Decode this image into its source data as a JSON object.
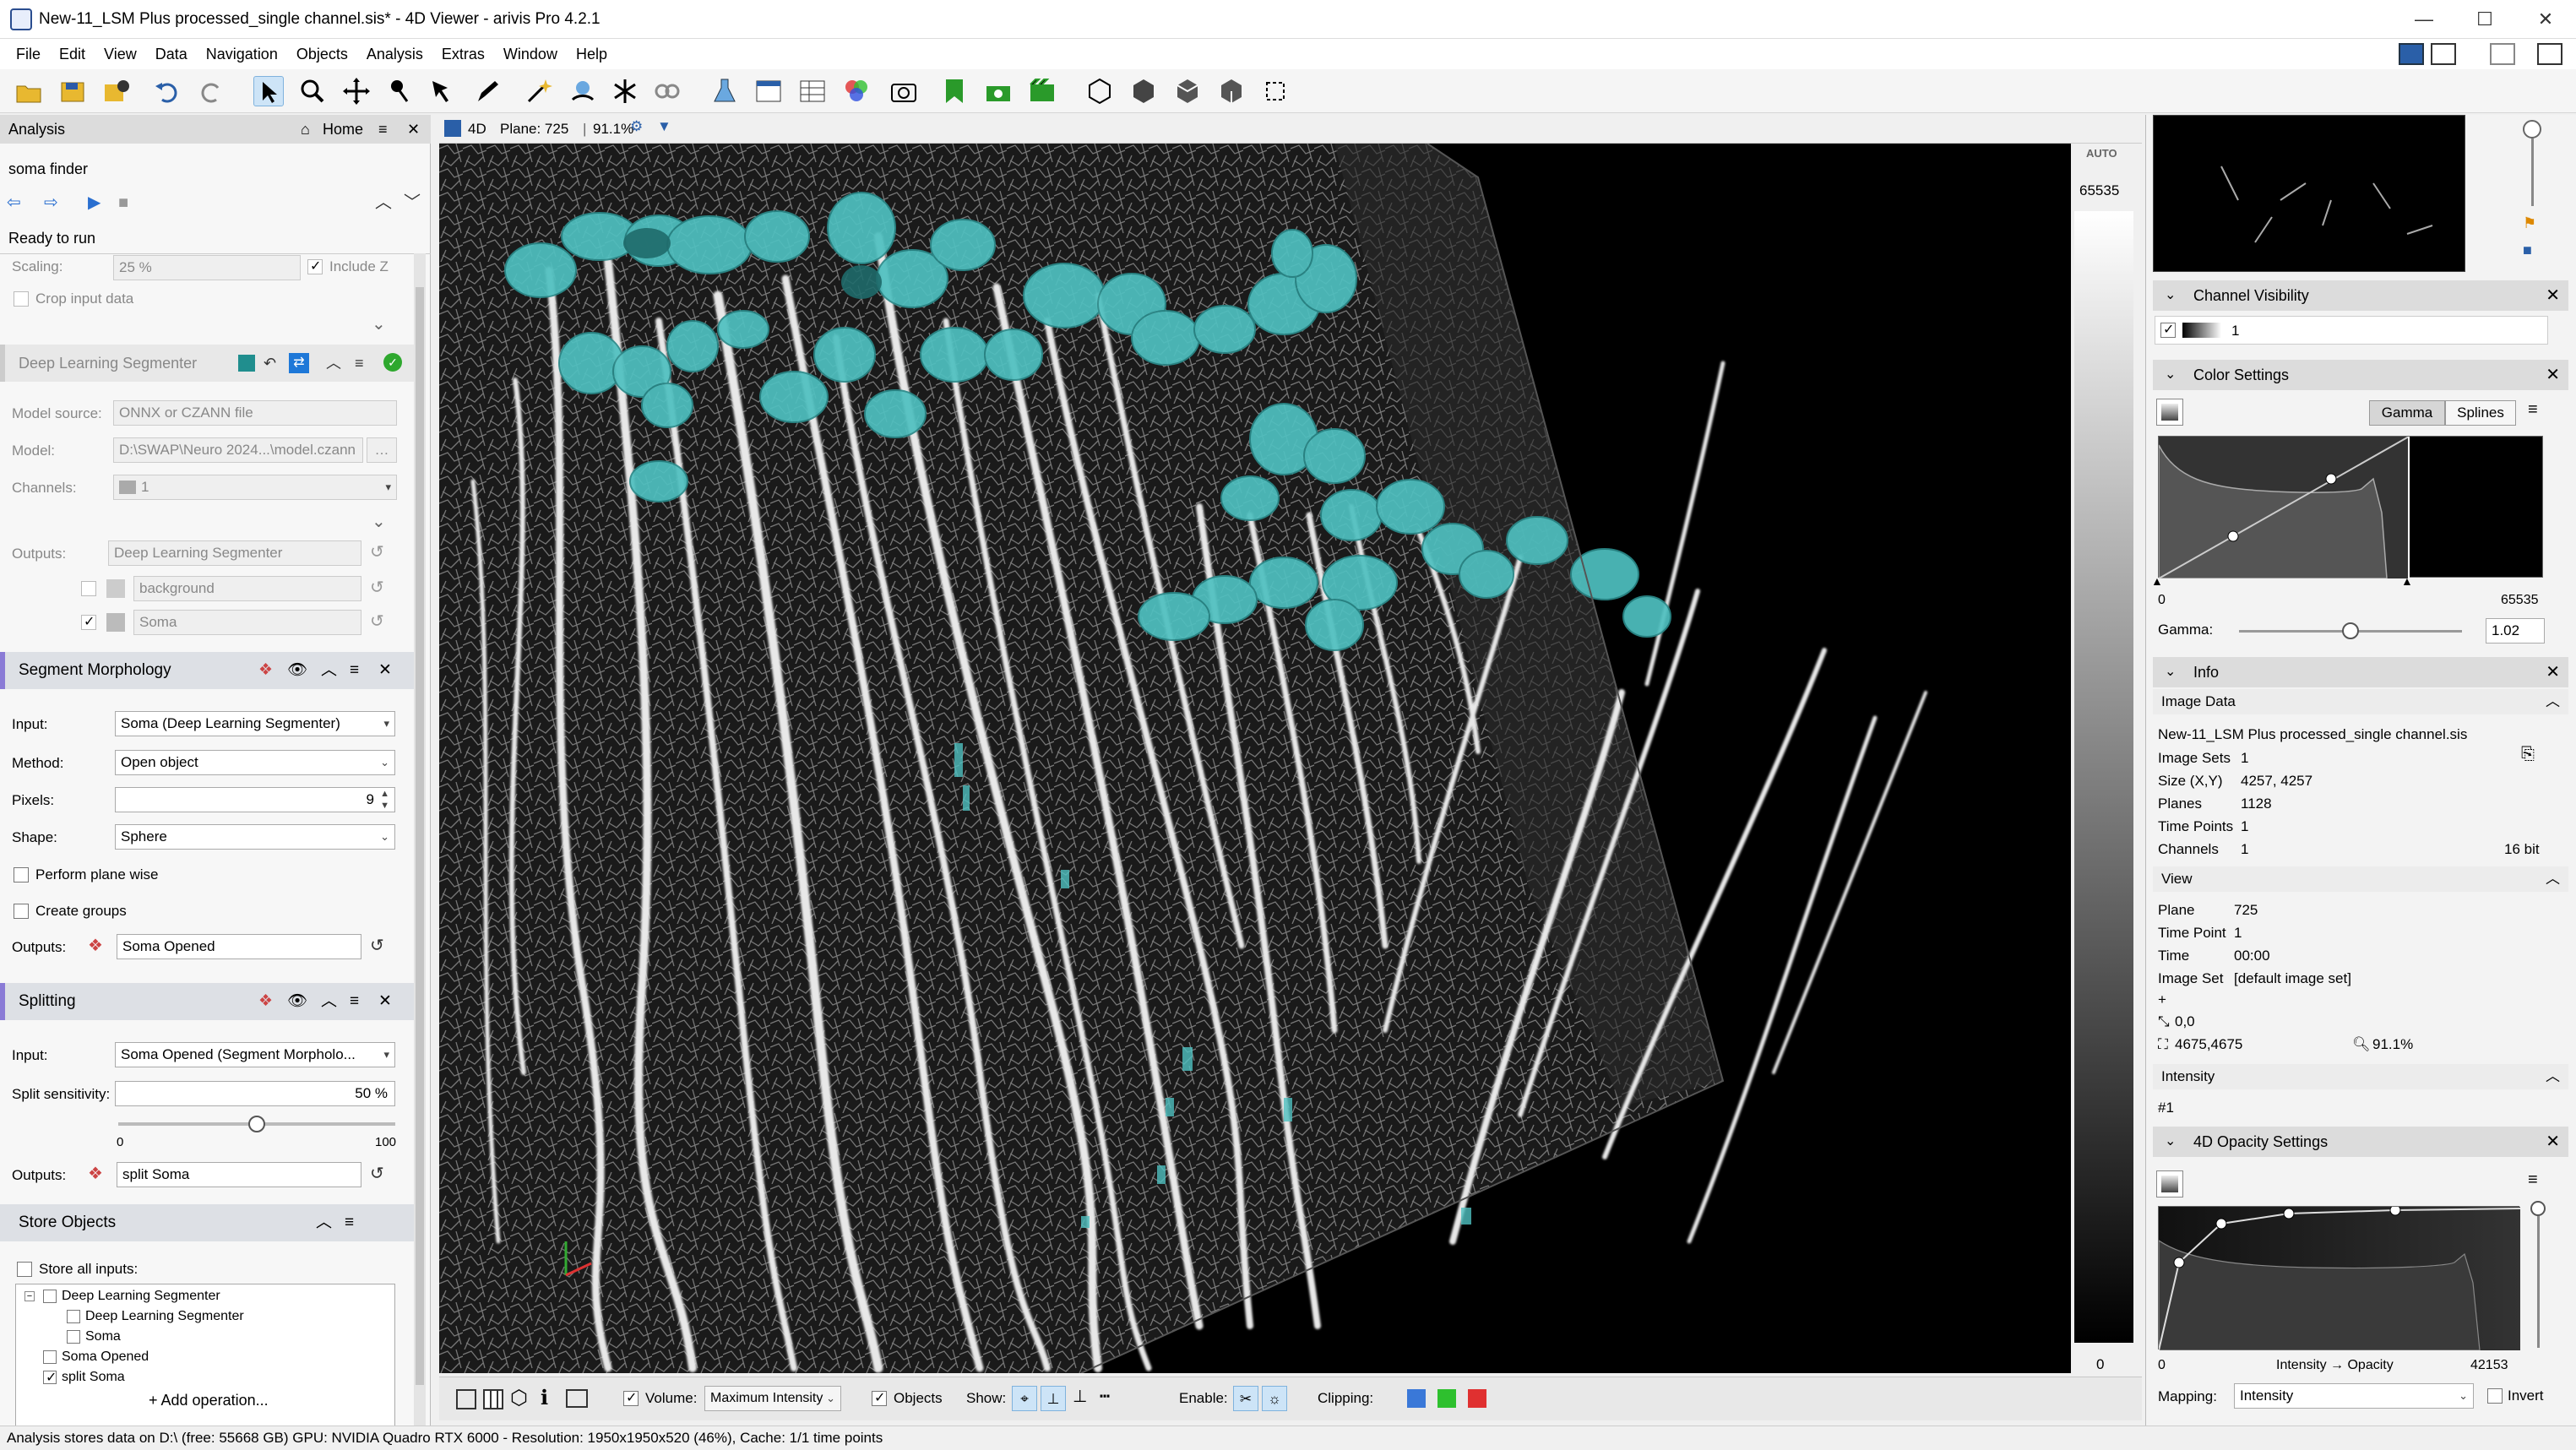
{
  "window": {
    "title": "New-11_LSM Plus processed_single channel.sis* - 4D Viewer - arivis Pro 4.2.1"
  },
  "menu": [
    "File",
    "Edit",
    "View",
    "Data",
    "Navigation",
    "Objects",
    "Analysis",
    "Extras",
    "Window",
    "Help"
  ],
  "analysis": {
    "panel_title": "Analysis",
    "home_label": "Home",
    "pipeline_name": "soma finder",
    "status": "Ready to run",
    "scaling_label": "Scaling:",
    "scaling_value": "25 %",
    "include_z_label": "Include Z",
    "crop_label": "Crop input data",
    "dls": {
      "title": "Deep Learning Segmenter",
      "model_source_label": "Model source:",
      "model_source_value": "ONNX or CZANN file",
      "model_label": "Model:",
      "model_value": "D:\\SWAP\\Neuro 2024...\\model.czann",
      "channels_label": "Channels:",
      "channels_value": "1",
      "outputs_label": "Outputs:",
      "outputs_value": "Deep Learning Segmenter",
      "class1": "background",
      "class2": "Soma"
    },
    "morph": {
      "title": "Segment Morphology",
      "input_label": "Input:",
      "input_value": "Soma (Deep Learning Segmenter)",
      "method_label": "Method:",
      "method_value": "Open object",
      "pixels_label": "Pixels:",
      "pixels_value": "9",
      "shape_label": "Shape:",
      "shape_value": "Sphere",
      "plane_wise_label": "Perform plane wise",
      "groups_label": "Create groups",
      "outputs_label": "Outputs:",
      "outputs_value": "Soma Opened"
    },
    "split": {
      "title": "Splitting",
      "input_label": "Input:",
      "input_value": "Soma Opened (Segment Morpholo...",
      "sens_label": "Split sensitivity:",
      "sens_value": "50 %",
      "slider_min": "0",
      "slider_max": "100",
      "slider_level": 0.5,
      "outputs_label": "Outputs:",
      "outputs_value": "split Soma"
    },
    "store": {
      "title": "Store Objects",
      "store_all_label": "Store all inputs:",
      "tree": [
        "Deep Learning Segmenter",
        "Deep Learning Segmenter",
        "Soma",
        "Soma Opened",
        "split Soma"
      ]
    },
    "add_operation": "+ Add operation..."
  },
  "viewer": {
    "mode": "4D",
    "plane": "Plane: 725",
    "zoom": "91.1%",
    "scale_top": "65535",
    "scale_bottom": "0",
    "auto": "AUTO",
    "volume_label": "Volume:",
    "volume_value": "Maximum Intensity",
    "objects_label": "Objects",
    "show_label": "Show:",
    "enable_label": "Enable:",
    "clipping_label": "Clipping:"
  },
  "right": {
    "channel_visibility": "Channel Visibility",
    "channel_1": "1",
    "color_settings": "Color Settings",
    "gamma_tab": "Gamma",
    "splines_tab": "Splines",
    "range_min": "0",
    "range_max": "65535",
    "gamma_label": "Gamma:",
    "gamma_value": "1.02",
    "info": "Info",
    "image_data": "Image Data",
    "file": "New-11_LSM Plus processed_single channel.sis",
    "image_sets_label": "Image Sets",
    "image_sets": "1",
    "size_label": "Size (X,Y)",
    "size": "4257, 4257",
    "planes_label": "Planes",
    "planes": "1128",
    "timepoints_label": "Time Points",
    "timepoints": "1",
    "channels_label": "Channels",
    "channels": "1",
    "bitdepth": "16 bit",
    "view": "View",
    "plane_label": "Plane",
    "plane": "725",
    "timepoint_label": "Time Point",
    "timepoint": "1",
    "time_label": "Time",
    "time": "00:00",
    "imageset_label": "Image Set",
    "imageset": "[default image set]",
    "plus": "+",
    "origin": "0,0",
    "viewsize": "4675,4675",
    "zoom": "91.1%",
    "intensity": "Intensity",
    "intensity_value": "#1",
    "opacity": "4D Opacity Settings",
    "op_min": "0",
    "op_axis": "Intensity → Opacity",
    "op_max": "42153",
    "mapping_label": "Mapping:",
    "mapping_value": "Intensity",
    "invert_label": "Invert"
  },
  "status": "Analysis stores data on D:\\ (free: 55668 GB)  GPU: NVIDIA Quadro RTX 6000 - Resolution: 1950x1950x520 (46%), Cache: 1/1 time points"
}
